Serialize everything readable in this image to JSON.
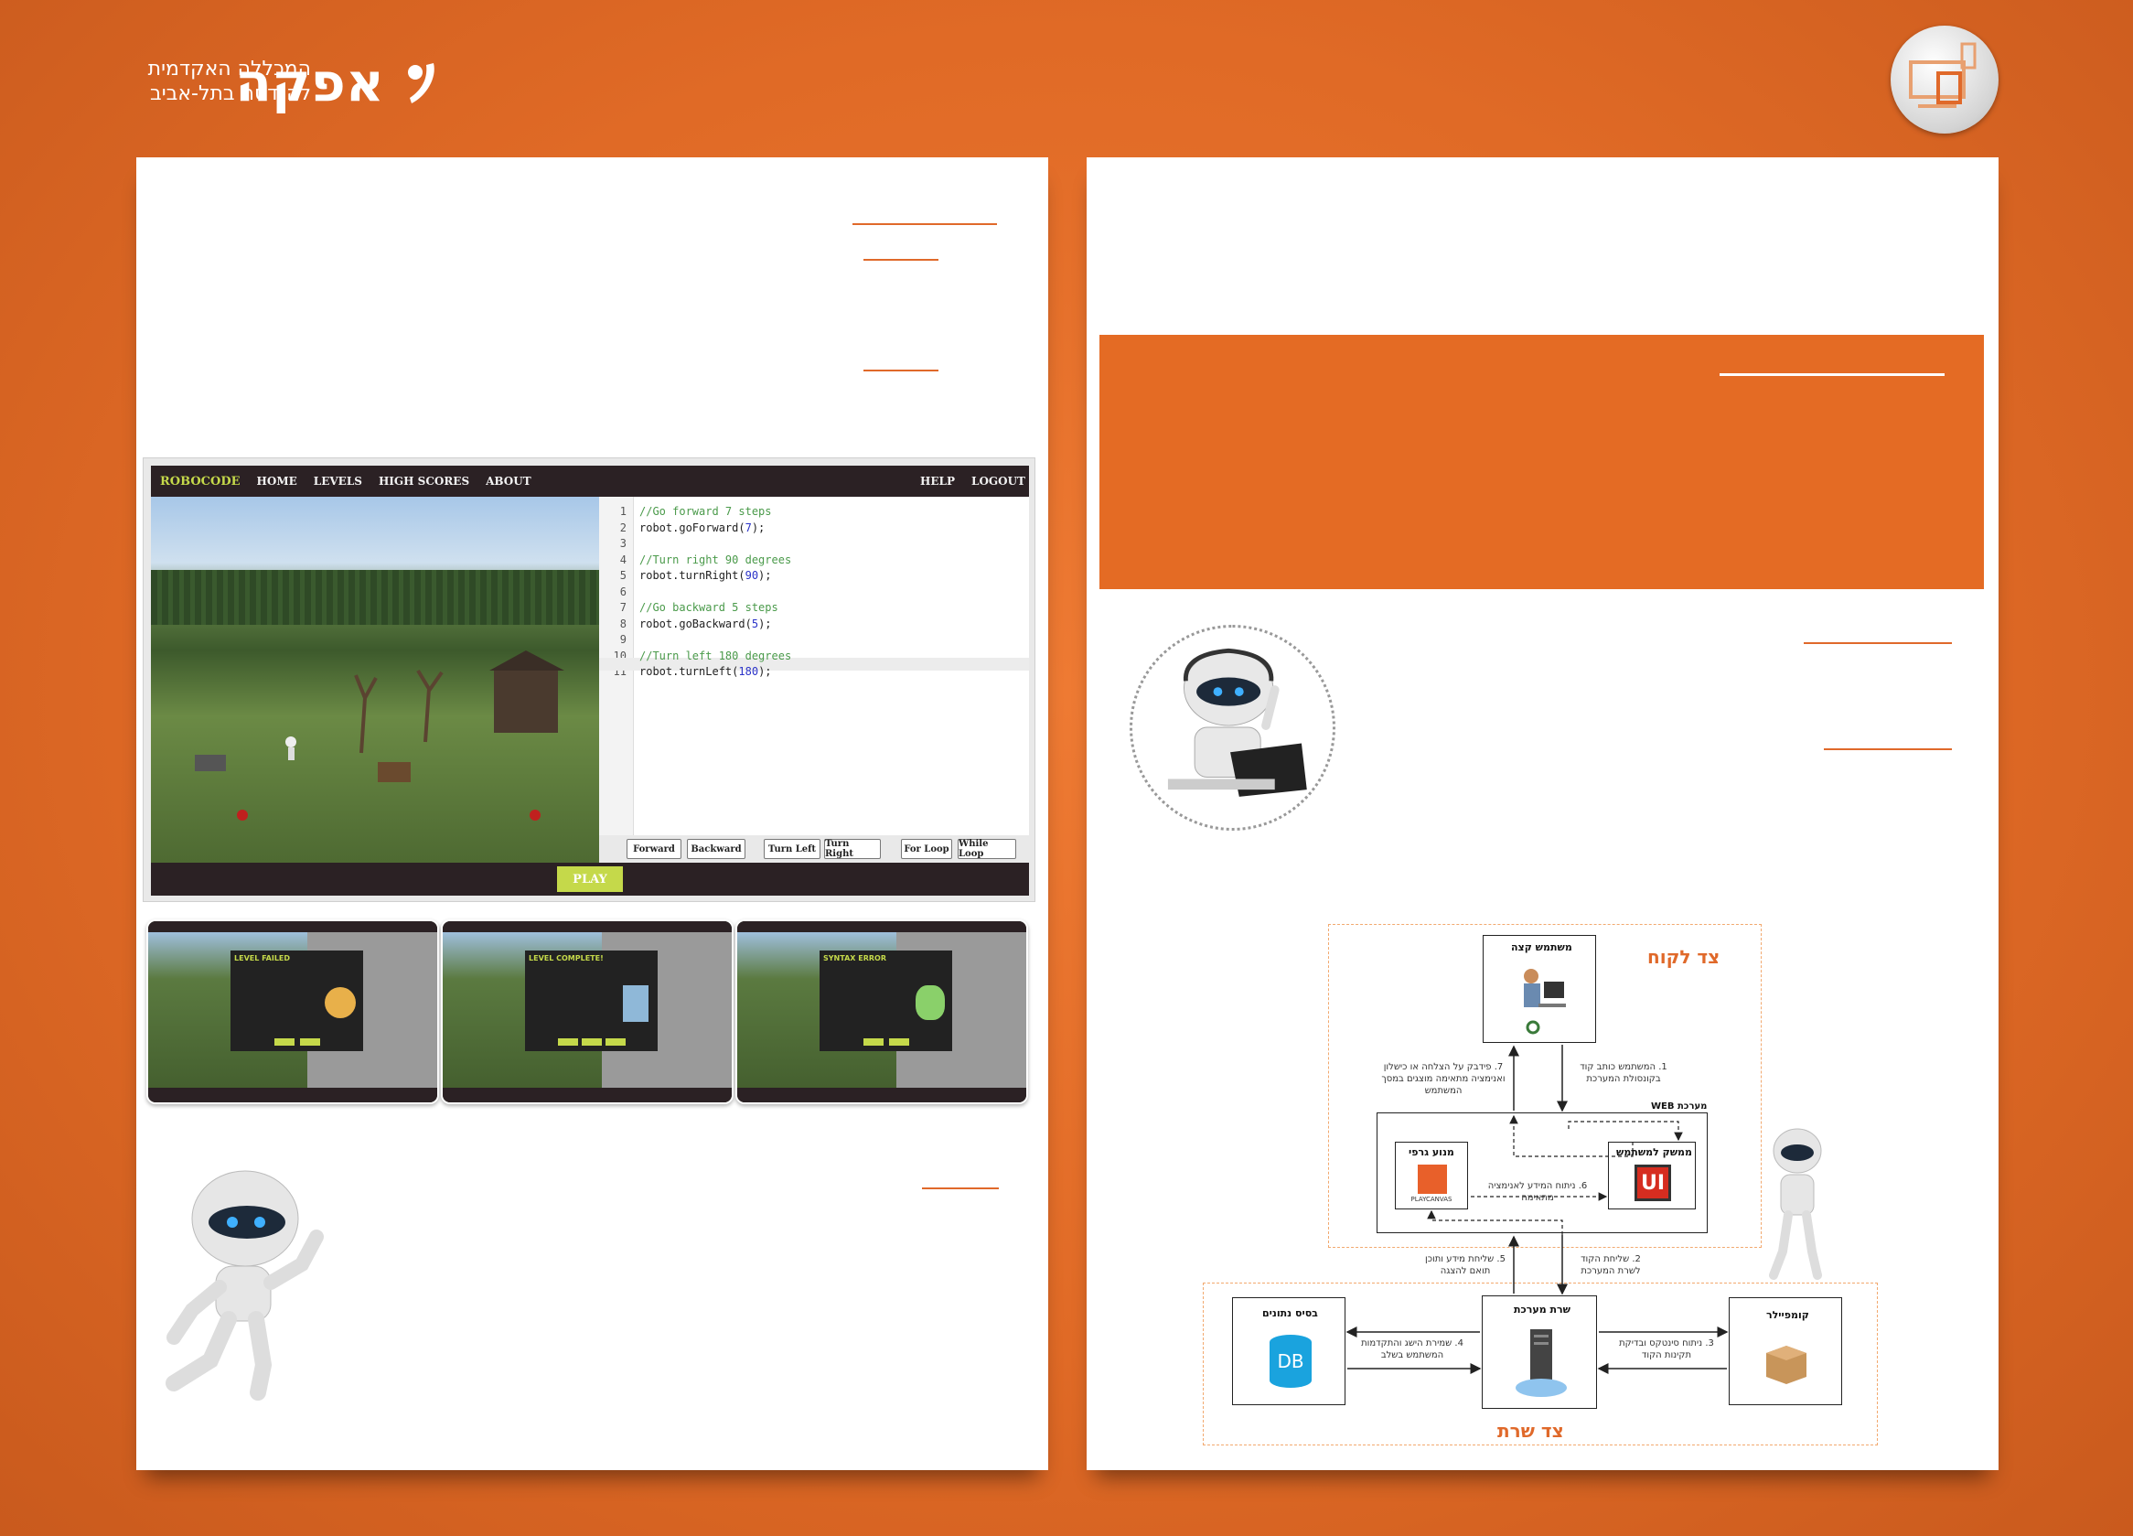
{
  "header": {
    "logo_name": "אפקה",
    "logo_line1": "המכללה האקדמית",
    "logo_line2": "להנדסה בתל-אביב"
  },
  "game": {
    "brand": "ROBOCODE",
    "nav": [
      "HOME",
      "LEVELS",
      "HIGH SCORES",
      "ABOUT"
    ],
    "nav_right": [
      "HELP",
      "LOGOUT"
    ],
    "line_numbers": [
      "1",
      "2",
      "3",
      "4",
      "5",
      "6",
      "7",
      "8",
      "9",
      "10",
      "11"
    ],
    "code_lines": [
      {
        "type": "comment",
        "text": "//Go forward 7 steps"
      },
      {
        "type": "code",
        "pre": "robot.goForward(",
        "num": "7",
        "post": ");"
      },
      {
        "type": "blank",
        "text": ""
      },
      {
        "type": "comment",
        "text": "//Turn right 90 degrees"
      },
      {
        "type": "code",
        "pre": "robot.turnRight(",
        "num": "90",
        "post": ");"
      },
      {
        "type": "blank",
        "text": ""
      },
      {
        "type": "comment",
        "text": "//Go backward 5 steps"
      },
      {
        "type": "code",
        "pre": "robot.goBackward(",
        "num": "5",
        "post": ");"
      },
      {
        "type": "blank",
        "text": ""
      },
      {
        "type": "comment",
        "text": "//Turn left 180 degrees"
      },
      {
        "type": "code",
        "pre": "robot.turnLeft(",
        "num": "180",
        "post": ");"
      }
    ],
    "buttons": [
      "Forward",
      "Backward",
      "Turn Left",
      "Turn Right",
      "For Loop",
      "While Loop"
    ],
    "play_label": "PLAY"
  },
  "thumbnails": [
    {
      "title": "LEVEL FAILED"
    },
    {
      "title": "LEVEL COMPLETE!"
    },
    {
      "title": "SYNTAX ERROR"
    }
  ],
  "diagram": {
    "client_side": "צד לקוח",
    "server_side": "צד שרת",
    "end_user": "משתמש קצה",
    "web_system": "מערכת WEB",
    "graphics_engine": "מנוע גרפי",
    "user_interface": "ממשק למשתמש",
    "playcanvas": "PLAYCANVAS",
    "ui_icon": "UI",
    "system_server": "שרת מערכת",
    "database": "בסיס נתונים",
    "db_icon": "DB",
    "compiler": "קומפיילר",
    "step1": "1. המשתמש כותב קוד בקונסולת המערכת",
    "step2": "2. שליחת הקוד לשרת המערכת",
    "step3": "3. ניתוח סינטקס ובדיקת תקינות הקוד",
    "step4": "4. שמירת הישג והתקדמות המשתמש בשלב",
    "step5": "5. שליחת מידע ותוכן תואם להצגה",
    "step6": "6. ניתוח המידע לאנימציה מתאימה",
    "step7": "7. פידבק על הצלחה או כישלון ואנימציה מתאימה מוצגים במסך המשתמש"
  },
  "colors": {
    "accent": "#e0692a",
    "brand_green": "#c5d94a",
    "nav_dark": "#2b2124"
  }
}
